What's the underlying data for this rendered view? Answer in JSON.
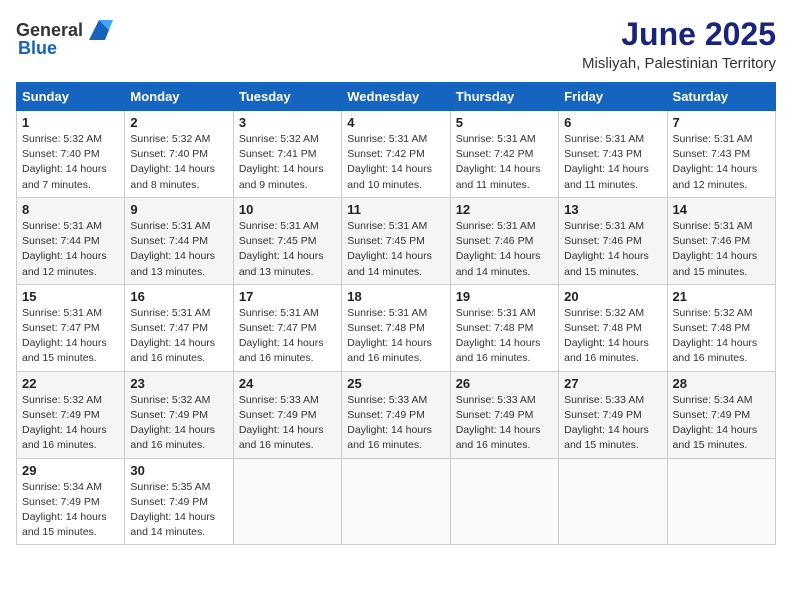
{
  "header": {
    "logo_general": "General",
    "logo_blue": "Blue",
    "month_year": "June 2025",
    "location": "Misliyah, Palestinian Territory"
  },
  "days_of_week": [
    "Sunday",
    "Monday",
    "Tuesday",
    "Wednesday",
    "Thursday",
    "Friday",
    "Saturday"
  ],
  "weeks": [
    [
      {
        "day": "1",
        "sunrise": "5:32 AM",
        "sunset": "7:40 PM",
        "daylight": "14 hours and 7 minutes."
      },
      {
        "day": "2",
        "sunrise": "5:32 AM",
        "sunset": "7:40 PM",
        "daylight": "14 hours and 8 minutes."
      },
      {
        "day": "3",
        "sunrise": "5:32 AM",
        "sunset": "7:41 PM",
        "daylight": "14 hours and 9 minutes."
      },
      {
        "day": "4",
        "sunrise": "5:31 AM",
        "sunset": "7:42 PM",
        "daylight": "14 hours and 10 minutes."
      },
      {
        "day": "5",
        "sunrise": "5:31 AM",
        "sunset": "7:42 PM",
        "daylight": "14 hours and 11 minutes."
      },
      {
        "day": "6",
        "sunrise": "5:31 AM",
        "sunset": "7:43 PM",
        "daylight": "14 hours and 11 minutes."
      },
      {
        "day": "7",
        "sunrise": "5:31 AM",
        "sunset": "7:43 PM",
        "daylight": "14 hours and 12 minutes."
      }
    ],
    [
      {
        "day": "8",
        "sunrise": "5:31 AM",
        "sunset": "7:44 PM",
        "daylight": "14 hours and 12 minutes."
      },
      {
        "day": "9",
        "sunrise": "5:31 AM",
        "sunset": "7:44 PM",
        "daylight": "14 hours and 13 minutes."
      },
      {
        "day": "10",
        "sunrise": "5:31 AM",
        "sunset": "7:45 PM",
        "daylight": "14 hours and 13 minutes."
      },
      {
        "day": "11",
        "sunrise": "5:31 AM",
        "sunset": "7:45 PM",
        "daylight": "14 hours and 14 minutes."
      },
      {
        "day": "12",
        "sunrise": "5:31 AM",
        "sunset": "7:46 PM",
        "daylight": "14 hours and 14 minutes."
      },
      {
        "day": "13",
        "sunrise": "5:31 AM",
        "sunset": "7:46 PM",
        "daylight": "14 hours and 15 minutes."
      },
      {
        "day": "14",
        "sunrise": "5:31 AM",
        "sunset": "7:46 PM",
        "daylight": "14 hours and 15 minutes."
      }
    ],
    [
      {
        "day": "15",
        "sunrise": "5:31 AM",
        "sunset": "7:47 PM",
        "daylight": "14 hours and 15 minutes."
      },
      {
        "day": "16",
        "sunrise": "5:31 AM",
        "sunset": "7:47 PM",
        "daylight": "14 hours and 16 minutes."
      },
      {
        "day": "17",
        "sunrise": "5:31 AM",
        "sunset": "7:47 PM",
        "daylight": "14 hours and 16 minutes."
      },
      {
        "day": "18",
        "sunrise": "5:31 AM",
        "sunset": "7:48 PM",
        "daylight": "14 hours and 16 minutes."
      },
      {
        "day": "19",
        "sunrise": "5:31 AM",
        "sunset": "7:48 PM",
        "daylight": "14 hours and 16 minutes."
      },
      {
        "day": "20",
        "sunrise": "5:32 AM",
        "sunset": "7:48 PM",
        "daylight": "14 hours and 16 minutes."
      },
      {
        "day": "21",
        "sunrise": "5:32 AM",
        "sunset": "7:48 PM",
        "daylight": "14 hours and 16 minutes."
      }
    ],
    [
      {
        "day": "22",
        "sunrise": "5:32 AM",
        "sunset": "7:49 PM",
        "daylight": "14 hours and 16 minutes."
      },
      {
        "day": "23",
        "sunrise": "5:32 AM",
        "sunset": "7:49 PM",
        "daylight": "14 hours and 16 minutes."
      },
      {
        "day": "24",
        "sunrise": "5:33 AM",
        "sunset": "7:49 PM",
        "daylight": "14 hours and 16 minutes."
      },
      {
        "day": "25",
        "sunrise": "5:33 AM",
        "sunset": "7:49 PM",
        "daylight": "14 hours and 16 minutes."
      },
      {
        "day": "26",
        "sunrise": "5:33 AM",
        "sunset": "7:49 PM",
        "daylight": "14 hours and 16 minutes."
      },
      {
        "day": "27",
        "sunrise": "5:33 AM",
        "sunset": "7:49 PM",
        "daylight": "14 hours and 15 minutes."
      },
      {
        "day": "28",
        "sunrise": "5:34 AM",
        "sunset": "7:49 PM",
        "daylight": "14 hours and 15 minutes."
      }
    ],
    [
      {
        "day": "29",
        "sunrise": "5:34 AM",
        "sunset": "7:49 PM",
        "daylight": "14 hours and 15 minutes."
      },
      {
        "day": "30",
        "sunrise": "5:35 AM",
        "sunset": "7:49 PM",
        "daylight": "14 hours and 14 minutes."
      },
      null,
      null,
      null,
      null,
      null
    ]
  ],
  "labels": {
    "sunrise": "Sunrise:",
    "sunset": "Sunset:",
    "daylight": "Daylight:"
  }
}
